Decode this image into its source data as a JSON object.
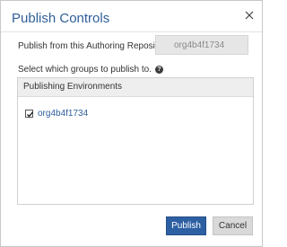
{
  "dialog": {
    "title": "Publish Controls",
    "close_icon": "close-icon"
  },
  "repository": {
    "label": "Publish from this Authoring Repository:",
    "value": "org4b4f1734"
  },
  "groups": {
    "label": "Select which groups to publish to.",
    "help_icon": "question-circle-icon"
  },
  "environments": {
    "header": "Publishing Environments",
    "items": [
      {
        "label": "org4b4f1734",
        "checked": true
      }
    ]
  },
  "buttons": {
    "publish_label": "Publish",
    "cancel_label": "Cancel"
  },
  "colors": {
    "accent": "#2e5f99",
    "publish_button": "#2d5fa3",
    "cancel_button": "#d9d9d9"
  }
}
